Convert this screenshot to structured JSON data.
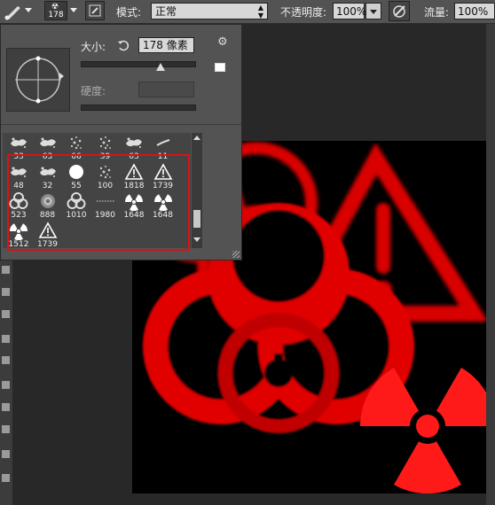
{
  "options_bar": {
    "brush_size": "178",
    "mode_label": "模式:",
    "mode_value": "正常",
    "opacity_label": "不透明度:",
    "opacity_value": "100%",
    "flow_label": "流量:",
    "flow_value": "100%"
  },
  "brush_panel": {
    "size_label": "大小:",
    "size_value": "178 像素",
    "hardness_label": "硬度:",
    "hardness_value": ""
  },
  "presets": [
    {
      "num": "33",
      "icon": "splatter-brush-icon"
    },
    {
      "num": "63",
      "icon": "splatter-brush-icon"
    },
    {
      "num": "66",
      "icon": "scatter-brush-icon"
    },
    {
      "num": "39",
      "icon": "scatter-brush-icon"
    },
    {
      "num": "63",
      "icon": "splatter-brush-icon"
    },
    {
      "num": "11",
      "icon": "stroke-brush-icon"
    },
    {
      "num": "48",
      "icon": "splatter-brush-icon"
    },
    {
      "num": "32",
      "icon": "splatter-brush-icon"
    },
    {
      "num": "55",
      "icon": "round-brush-icon"
    },
    {
      "num": "100",
      "icon": "scatter-brush-icon"
    },
    {
      "num": "1818",
      "icon": "warning-brush-icon"
    },
    {
      "num": "1739",
      "icon": "warning-brush-icon"
    },
    {
      "num": "523",
      "icon": "biohazard-brush-icon"
    },
    {
      "num": "888",
      "icon": "gear-brush-icon"
    },
    {
      "num": "1010",
      "icon": "biohazard-brush-icon"
    },
    {
      "num": "1980",
      "icon": "dotted-line-brush-icon"
    },
    {
      "num": "1648",
      "icon": "radiation-brush-icon"
    },
    {
      "num": "1648",
      "icon": "radiation-brush-icon"
    },
    {
      "num": "1512",
      "icon": "radiation-brush-icon"
    },
    {
      "num": "1739",
      "icon": "warning-brush-icon"
    }
  ],
  "colors": {
    "accent_red": "#ff0000",
    "selection_red": "#dd1111",
    "panel_bg": "#535353"
  }
}
